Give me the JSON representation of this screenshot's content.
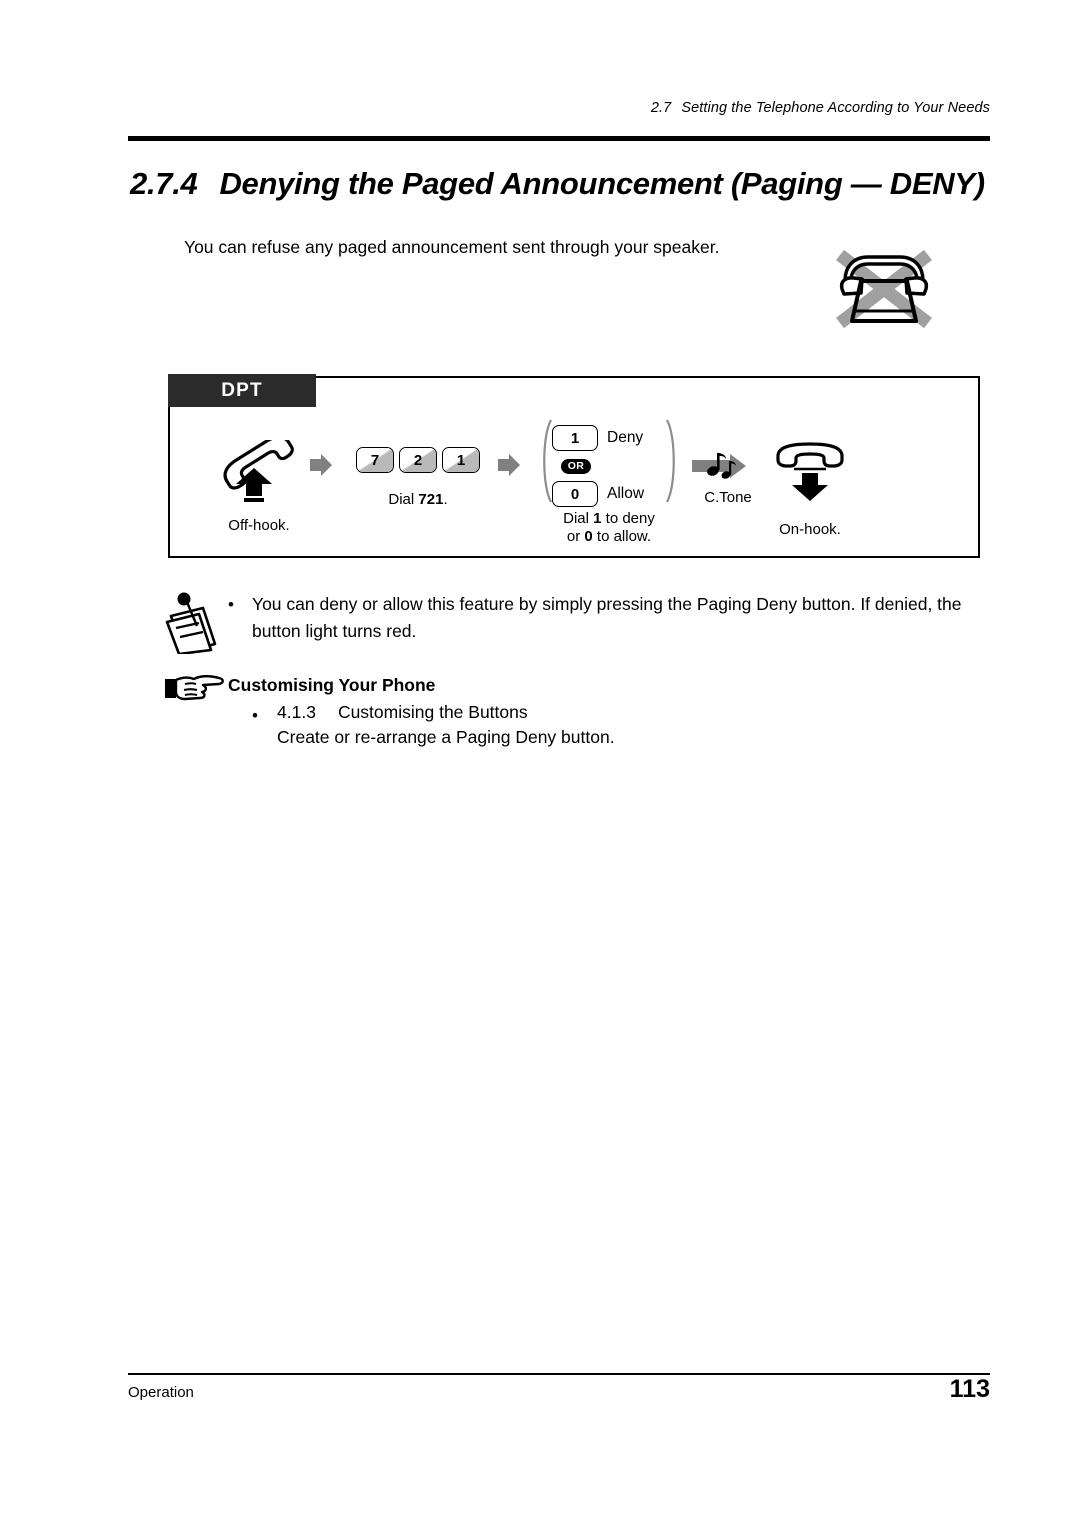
{
  "header": {
    "section_number": "2.7",
    "section_title": "Setting the Telephone According to Your Needs"
  },
  "title": {
    "number": "2.7.4",
    "text": "Denying the Paged Announcement (Paging — DENY)"
  },
  "intro": "You can refuse any paged announcement sent through your speaker.",
  "phone_type_icon": "crossed-telephone-icon",
  "diagram": {
    "label": "DPT",
    "steps": [
      {
        "icon": "handset-off-hook-icon",
        "caption": "Off-hook."
      },
      {
        "keys": [
          "7",
          "2",
          "1"
        ],
        "caption_prefix": "Dial ",
        "caption_bold": "721",
        "caption_suffix": "."
      },
      {
        "options": [
          {
            "key": "1",
            "label": "Deny"
          },
          {
            "key": "0",
            "label": "Allow"
          }
        ],
        "separator": "OR",
        "caption_line1_prefix": "Dial ",
        "caption_line1_bold": "1",
        "caption_line1_suffix": " to deny",
        "caption_line2_prefix": "or ",
        "caption_line2_bold": "0",
        "caption_line2_suffix": " to allow."
      },
      {
        "icon": "confirmation-tone-icon",
        "caption": "C.Tone"
      },
      {
        "icon": "handset-on-hook-icon",
        "caption": "On-hook."
      }
    ]
  },
  "note": {
    "icon": "notepad-pen-icon",
    "bullet": "•",
    "text": "You can deny or allow this feature by simply pressing the Paging Deny button. If denied, the button light turns red."
  },
  "customising": {
    "icon": "pointing-hand-icon",
    "heading": "Customising Your Phone",
    "bullet": "•",
    "ref_number": "4.1.3",
    "ref_title": "Customising the Buttons",
    "description": "Create or re-arrange a Paging Deny button."
  },
  "footer": {
    "left": "Operation",
    "page_number": "113"
  },
  "colors": {
    "tab_background": "#2b2b2b",
    "key_shade": "#b9b9b9",
    "arrow_gray": "#808080",
    "cross_gray": "#a0a0a0"
  }
}
